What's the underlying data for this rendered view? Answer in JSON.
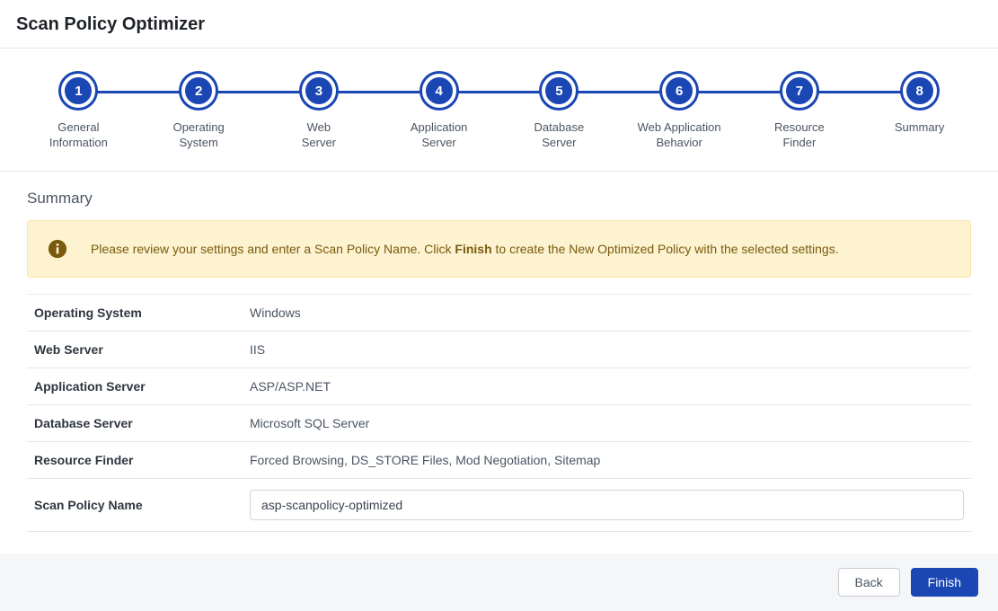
{
  "title": "Scan Policy Optimizer",
  "steps": [
    {
      "num": "1",
      "label": "General\nInformation"
    },
    {
      "num": "2",
      "label": "Operating\nSystem"
    },
    {
      "num": "3",
      "label": "Web\nServer"
    },
    {
      "num": "4",
      "label": "Application\nServer"
    },
    {
      "num": "5",
      "label": "Database\nServer"
    },
    {
      "num": "6",
      "label": "Web Application\nBehavior"
    },
    {
      "num": "7",
      "label": "Resource\nFinder"
    },
    {
      "num": "8",
      "label": "Summary"
    }
  ],
  "sectionHeading": "Summary",
  "banner": {
    "prefix": "Please review your settings and enter a Scan Policy Name. Click ",
    "bold": "Finish",
    "suffix": " to create the New Optimized Policy with the selected settings."
  },
  "rows": [
    {
      "label": "Operating System",
      "value": "Windows"
    },
    {
      "label": "Web Server",
      "value": "IIS"
    },
    {
      "label": "Application Server",
      "value": "ASP/ASP.NET"
    },
    {
      "label": "Database Server",
      "value": "Microsoft SQL Server"
    },
    {
      "label": "Resource Finder",
      "value": "Forced Browsing, DS_STORE Files, Mod Negotiation, Sitemap"
    }
  ],
  "policyName": {
    "label": "Scan Policy Name",
    "value": "asp-scanpolicy-optimized"
  },
  "buttons": {
    "back": "Back",
    "finish": "Finish"
  }
}
